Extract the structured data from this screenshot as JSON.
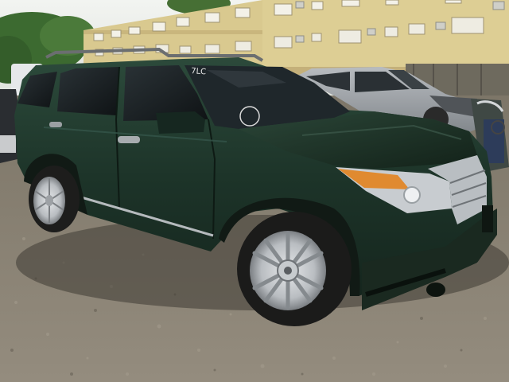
{
  "photo": {
    "subject": "dark-green-suv",
    "windshield_marking": "7LC",
    "colors": {
      "sky": "#e9ece8",
      "building": "#d9c98f",
      "building_trim": "#c7b27a",
      "suv_body": "#1c3328",
      "suv_highlight": "#2f4d3e",
      "glass": "#1a1f22",
      "ground": "#8b8375",
      "silver_car": "#9ea3a8",
      "foliage": "#3f6b32"
    }
  }
}
